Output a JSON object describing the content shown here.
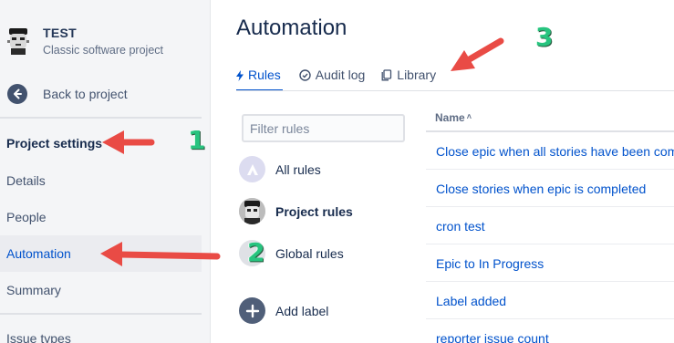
{
  "sidebar": {
    "project_name": "TEST",
    "project_type": "Classic software project",
    "back_label": "Back to project",
    "section_title": "Project settings",
    "items": [
      {
        "label": "Details"
      },
      {
        "label": "People"
      },
      {
        "label": "Automation"
      },
      {
        "label": "Summary"
      },
      {
        "label": "Issue types"
      }
    ]
  },
  "main": {
    "title": "Automation",
    "tabs": [
      {
        "label": "Rules",
        "icon": "lightning-icon"
      },
      {
        "label": "Audit log",
        "icon": "check-circle-icon"
      },
      {
        "label": "Library",
        "icon": "copy-icon"
      }
    ],
    "filter_placeholder": "Filter rules",
    "rule_options": [
      {
        "label": "All rules"
      },
      {
        "label": "Project rules"
      },
      {
        "label": "Global rules"
      },
      {
        "label": "Add label"
      }
    ],
    "table": {
      "column_name": "Name",
      "sort_indicator": "˄",
      "rows": [
        "Close epic when all stories have been completed",
        "Close stories when epic is completed",
        "cron test",
        "Epic to In Progress",
        "Label added",
        "reporter issue count"
      ]
    }
  },
  "annotations": [
    "1",
    "2",
    "3"
  ],
  "colors": {
    "accent": "#0052cc",
    "sidebar_bg": "#f4f5f7",
    "arrow": "#e94b45",
    "callout_number": "#27c47f"
  }
}
